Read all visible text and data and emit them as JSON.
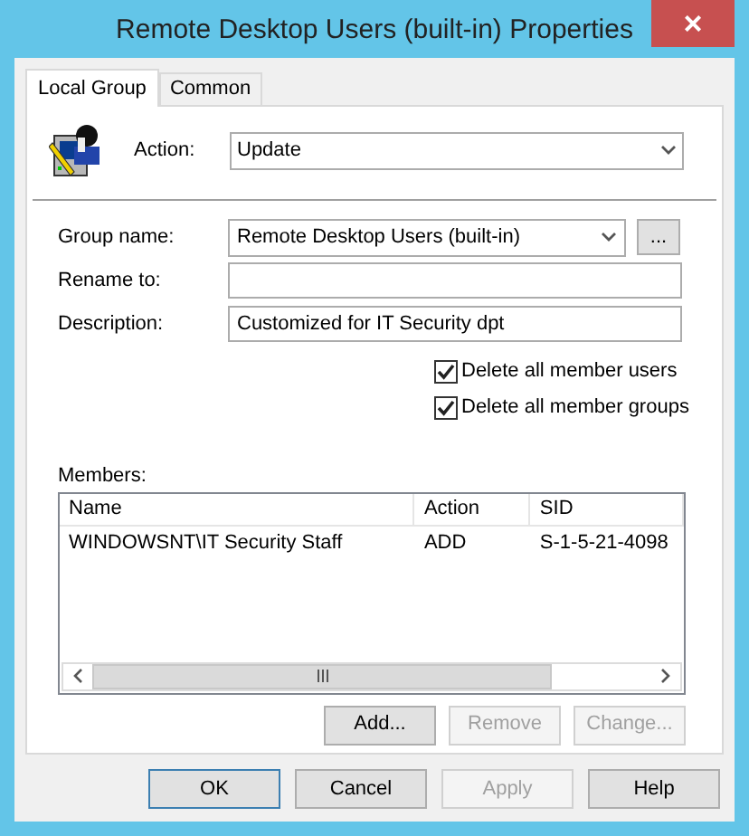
{
  "window": {
    "title": "Remote Desktop Users (built-in) Properties",
    "close": "×"
  },
  "tabs": [
    {
      "label": "Local Group",
      "selected": true
    },
    {
      "label": "Common",
      "selected": false
    }
  ],
  "action": {
    "label": "Action:",
    "value": "Update"
  },
  "fields": [
    {
      "kind": "combo",
      "label": "Group name:",
      "value": "Remote Desktop Users (built-in)",
      "browse": "..."
    },
    {
      "kind": "text",
      "label": "Rename to:"
    },
    {
      "kind": "text",
      "label": "Description:",
      "value": "Customized for IT Security dpt"
    }
  ],
  "options": [
    {
      "label": "Delete all member users",
      "checked": true
    },
    {
      "label": "Delete all member groups",
      "checked": true
    }
  ],
  "members": {
    "label": "Members:",
    "columns": [
      "Name",
      "Action",
      "SID"
    ],
    "rows": [
      {
        "cells": [
          "WINDOWSNT\\IT Security Staff",
          "ADD",
          "S-1-5-21-4098"
        ]
      }
    ]
  },
  "member_buttons": [
    {
      "label": "Add...",
      "disabled": false
    },
    {
      "label": "Remove",
      "disabled": true
    },
    {
      "label": "Change...",
      "disabled": true
    }
  ],
  "buttons": [
    {
      "label": "OK",
      "disabled": false,
      "default": true
    },
    {
      "label": "Cancel",
      "disabled": false,
      "default": false
    },
    {
      "label": "Apply",
      "disabled": true,
      "default": false
    },
    {
      "label": "Help",
      "disabled": false,
      "default": false
    }
  ]
}
